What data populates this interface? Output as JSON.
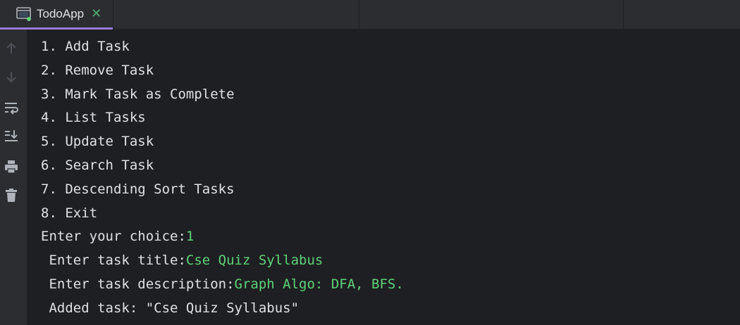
{
  "tab": {
    "title": "TodoApp",
    "close_symbol": "✕",
    "icon": "console-window-icon"
  },
  "gutter": {
    "icons": [
      "arrow-up-icon",
      "arrow-down-icon",
      "soft-wrap-icon",
      "scroll-to-end-icon",
      "print-icon",
      "trash-icon"
    ]
  },
  "console": {
    "lines": [
      {
        "text": "1. Add Task"
      },
      {
        "text": "2. Remove Task"
      },
      {
        "text": "3. Mark Task as Complete"
      },
      {
        "text": "4. List Tasks"
      },
      {
        "text": "5. Update Task"
      },
      {
        "text": "6. Search Task"
      },
      {
        "text": "7. Descending Sort Tasks"
      },
      {
        "text": "8. Exit"
      },
      {
        "text": "Enter your choice:",
        "input": "1"
      },
      {
        "text": " Enter task title:",
        "input": "Cse Quiz Syllabus"
      },
      {
        "text": " Enter task description:",
        "input": "Graph Algo: DFA, BFS."
      },
      {
        "text": " Added task: \"Cse Quiz Syllabus\""
      }
    ]
  },
  "colors": {
    "background": "#1e1f22",
    "panel": "#2b2d30",
    "text": "#dfe1e5",
    "user_input": "#5fd37a",
    "tab_underline": "#9a7ad8"
  }
}
